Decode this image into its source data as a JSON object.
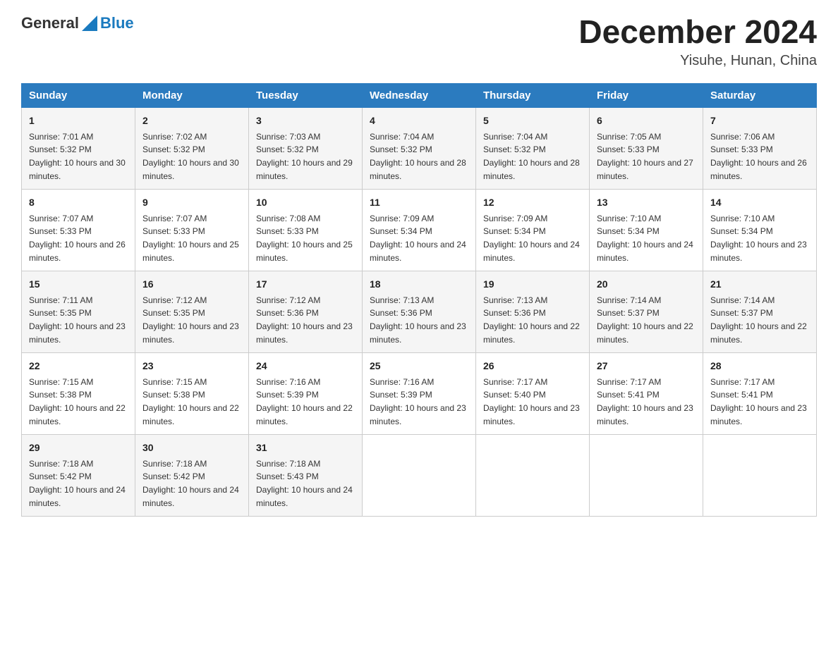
{
  "header": {
    "logo_general": "General",
    "logo_blue": "Blue",
    "month_title": "December 2024",
    "location": "Yisuhe, Hunan, China"
  },
  "days_of_week": [
    "Sunday",
    "Monday",
    "Tuesday",
    "Wednesday",
    "Thursday",
    "Friday",
    "Saturday"
  ],
  "weeks": [
    [
      {
        "day": "1",
        "sunrise": "7:01 AM",
        "sunset": "5:32 PM",
        "daylight": "10 hours and 30 minutes."
      },
      {
        "day": "2",
        "sunrise": "7:02 AM",
        "sunset": "5:32 PM",
        "daylight": "10 hours and 30 minutes."
      },
      {
        "day": "3",
        "sunrise": "7:03 AM",
        "sunset": "5:32 PM",
        "daylight": "10 hours and 29 minutes."
      },
      {
        "day": "4",
        "sunrise": "7:04 AM",
        "sunset": "5:32 PM",
        "daylight": "10 hours and 28 minutes."
      },
      {
        "day": "5",
        "sunrise": "7:04 AM",
        "sunset": "5:32 PM",
        "daylight": "10 hours and 28 minutes."
      },
      {
        "day": "6",
        "sunrise": "7:05 AM",
        "sunset": "5:33 PM",
        "daylight": "10 hours and 27 minutes."
      },
      {
        "day": "7",
        "sunrise": "7:06 AM",
        "sunset": "5:33 PM",
        "daylight": "10 hours and 26 minutes."
      }
    ],
    [
      {
        "day": "8",
        "sunrise": "7:07 AM",
        "sunset": "5:33 PM",
        "daylight": "10 hours and 26 minutes."
      },
      {
        "day": "9",
        "sunrise": "7:07 AM",
        "sunset": "5:33 PM",
        "daylight": "10 hours and 25 minutes."
      },
      {
        "day": "10",
        "sunrise": "7:08 AM",
        "sunset": "5:33 PM",
        "daylight": "10 hours and 25 minutes."
      },
      {
        "day": "11",
        "sunrise": "7:09 AM",
        "sunset": "5:34 PM",
        "daylight": "10 hours and 24 minutes."
      },
      {
        "day": "12",
        "sunrise": "7:09 AM",
        "sunset": "5:34 PM",
        "daylight": "10 hours and 24 minutes."
      },
      {
        "day": "13",
        "sunrise": "7:10 AM",
        "sunset": "5:34 PM",
        "daylight": "10 hours and 24 minutes."
      },
      {
        "day": "14",
        "sunrise": "7:10 AM",
        "sunset": "5:34 PM",
        "daylight": "10 hours and 23 minutes."
      }
    ],
    [
      {
        "day": "15",
        "sunrise": "7:11 AM",
        "sunset": "5:35 PM",
        "daylight": "10 hours and 23 minutes."
      },
      {
        "day": "16",
        "sunrise": "7:12 AM",
        "sunset": "5:35 PM",
        "daylight": "10 hours and 23 minutes."
      },
      {
        "day": "17",
        "sunrise": "7:12 AM",
        "sunset": "5:36 PM",
        "daylight": "10 hours and 23 minutes."
      },
      {
        "day": "18",
        "sunrise": "7:13 AM",
        "sunset": "5:36 PM",
        "daylight": "10 hours and 23 minutes."
      },
      {
        "day": "19",
        "sunrise": "7:13 AM",
        "sunset": "5:36 PM",
        "daylight": "10 hours and 22 minutes."
      },
      {
        "day": "20",
        "sunrise": "7:14 AM",
        "sunset": "5:37 PM",
        "daylight": "10 hours and 22 minutes."
      },
      {
        "day": "21",
        "sunrise": "7:14 AM",
        "sunset": "5:37 PM",
        "daylight": "10 hours and 22 minutes."
      }
    ],
    [
      {
        "day": "22",
        "sunrise": "7:15 AM",
        "sunset": "5:38 PM",
        "daylight": "10 hours and 22 minutes."
      },
      {
        "day": "23",
        "sunrise": "7:15 AM",
        "sunset": "5:38 PM",
        "daylight": "10 hours and 22 minutes."
      },
      {
        "day": "24",
        "sunrise": "7:16 AM",
        "sunset": "5:39 PM",
        "daylight": "10 hours and 22 minutes."
      },
      {
        "day": "25",
        "sunrise": "7:16 AM",
        "sunset": "5:39 PM",
        "daylight": "10 hours and 23 minutes."
      },
      {
        "day": "26",
        "sunrise": "7:17 AM",
        "sunset": "5:40 PM",
        "daylight": "10 hours and 23 minutes."
      },
      {
        "day": "27",
        "sunrise": "7:17 AM",
        "sunset": "5:41 PM",
        "daylight": "10 hours and 23 minutes."
      },
      {
        "day": "28",
        "sunrise": "7:17 AM",
        "sunset": "5:41 PM",
        "daylight": "10 hours and 23 minutes."
      }
    ],
    [
      {
        "day": "29",
        "sunrise": "7:18 AM",
        "sunset": "5:42 PM",
        "daylight": "10 hours and 24 minutes."
      },
      {
        "day": "30",
        "sunrise": "7:18 AM",
        "sunset": "5:42 PM",
        "daylight": "10 hours and 24 minutes."
      },
      {
        "day": "31",
        "sunrise": "7:18 AM",
        "sunset": "5:43 PM",
        "daylight": "10 hours and 24 minutes."
      },
      null,
      null,
      null,
      null
    ]
  ]
}
